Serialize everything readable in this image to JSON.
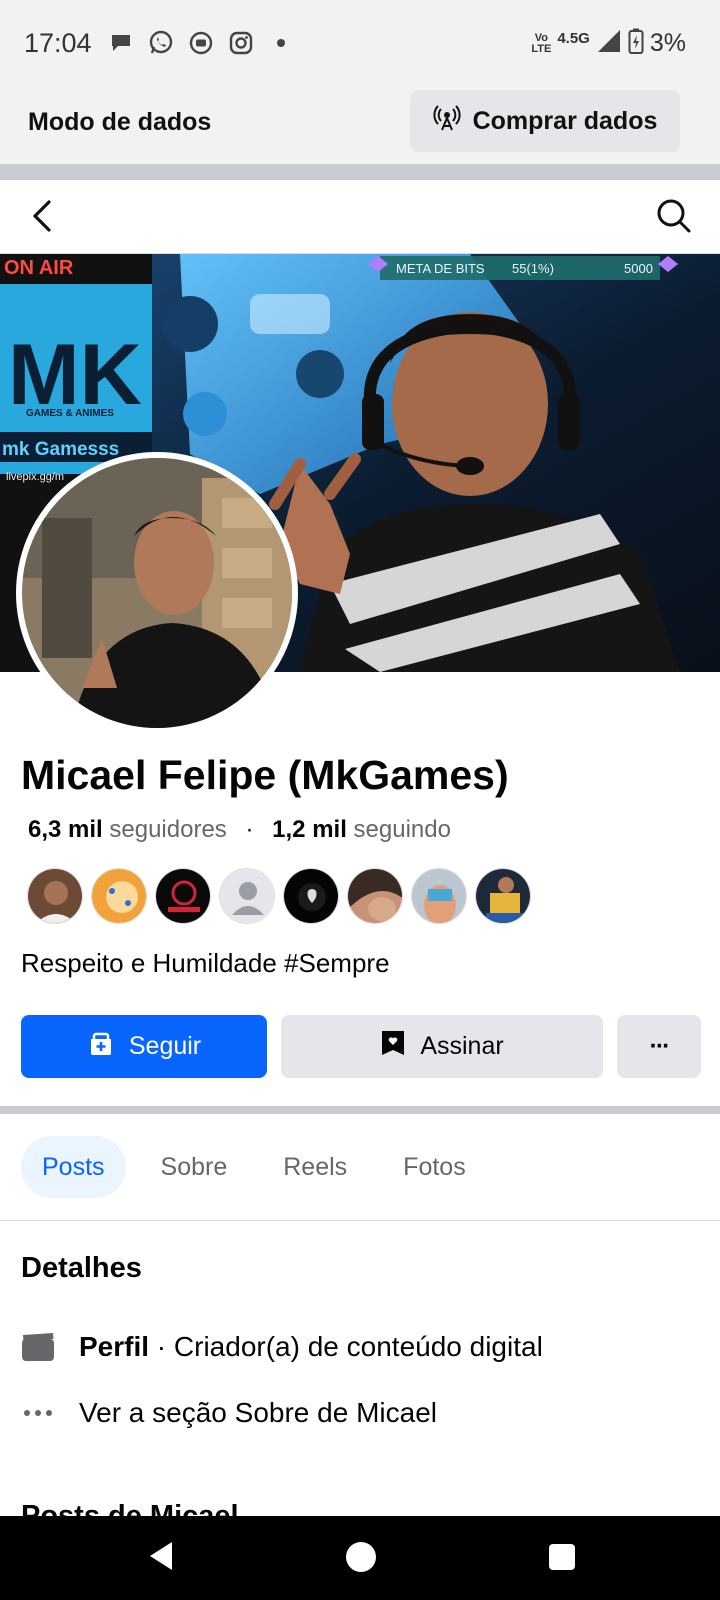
{
  "status_bar": {
    "time": "17:04",
    "notification_icons": [
      "chat-bubble-icon",
      "whatsapp-icon",
      "youtube-icon",
      "instagram-icon",
      "dot-icon"
    ],
    "volte_top": "Vo",
    "volte_bottom": "LTE",
    "network": "4.5G",
    "battery": "3%"
  },
  "data_banner": {
    "mode_label": "Modo de dados",
    "buy_label": "Comprar dados"
  },
  "cover": {
    "on_air": "ON AIR",
    "mk": "MK",
    "games_animes": "GAMES & ANIMES",
    "channel": "mk Gamesss",
    "livepix": "livepix.gg/m",
    "meta_label": "META DE BITS",
    "meta_progress": "55(1%)",
    "meta_goal": "5000"
  },
  "profile": {
    "name": "Micael Felipe (MkGames)",
    "followers_count": "6,3 mil",
    "followers_label": "seguidores",
    "separator": "·",
    "following_count": "1,2 mil",
    "following_label": "seguindo",
    "bio": "Respeito e Humildade #Sempre"
  },
  "actions": {
    "follow_label": "Seguir",
    "subscribe_label": "Assinar",
    "more_label": "···"
  },
  "tabs": [
    {
      "label": "Posts",
      "active": true
    },
    {
      "label": "Sobre",
      "active": false
    },
    {
      "label": "Reels",
      "active": false
    },
    {
      "label": "Fotos",
      "active": false
    }
  ],
  "details": {
    "title": "Detalhes",
    "profile_type_bold": "Perfil",
    "profile_type_rest": " · Criador(a) de conteúdo digital",
    "about_link": "Ver a seção Sobre de Micael",
    "posts_peek": "Posts de Micael"
  },
  "colors": {
    "accent": "#0866ff",
    "secondary_button": "#e4e6eb",
    "muted_text": "#65676b"
  }
}
